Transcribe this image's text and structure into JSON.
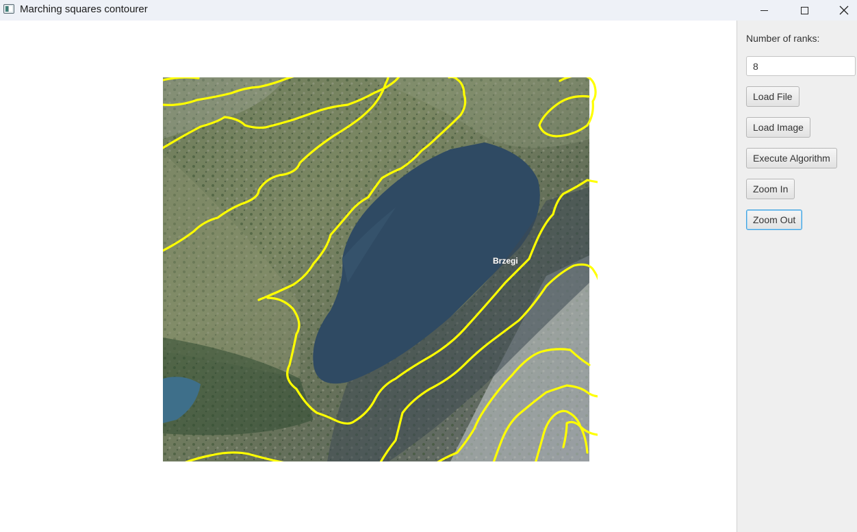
{
  "window": {
    "title": "Marching squares contourer",
    "controls": {
      "minimize_icon": "minimize-icon",
      "maximize_icon": "maximize-icon",
      "close_icon": "close-icon"
    }
  },
  "map": {
    "place_label": "Brzegi",
    "contour_color": "#ffff00",
    "water_color": "#2f4a63"
  },
  "panel": {
    "ranks_label": "Number of ranks:",
    "ranks_value": "8",
    "buttons": {
      "load_file": "Load File",
      "load_image": "Load Image",
      "execute": "Execute Algorithm",
      "zoom_in": "Zoom In",
      "zoom_out": "Zoom Out"
    },
    "focused_button": "zoom_out"
  }
}
